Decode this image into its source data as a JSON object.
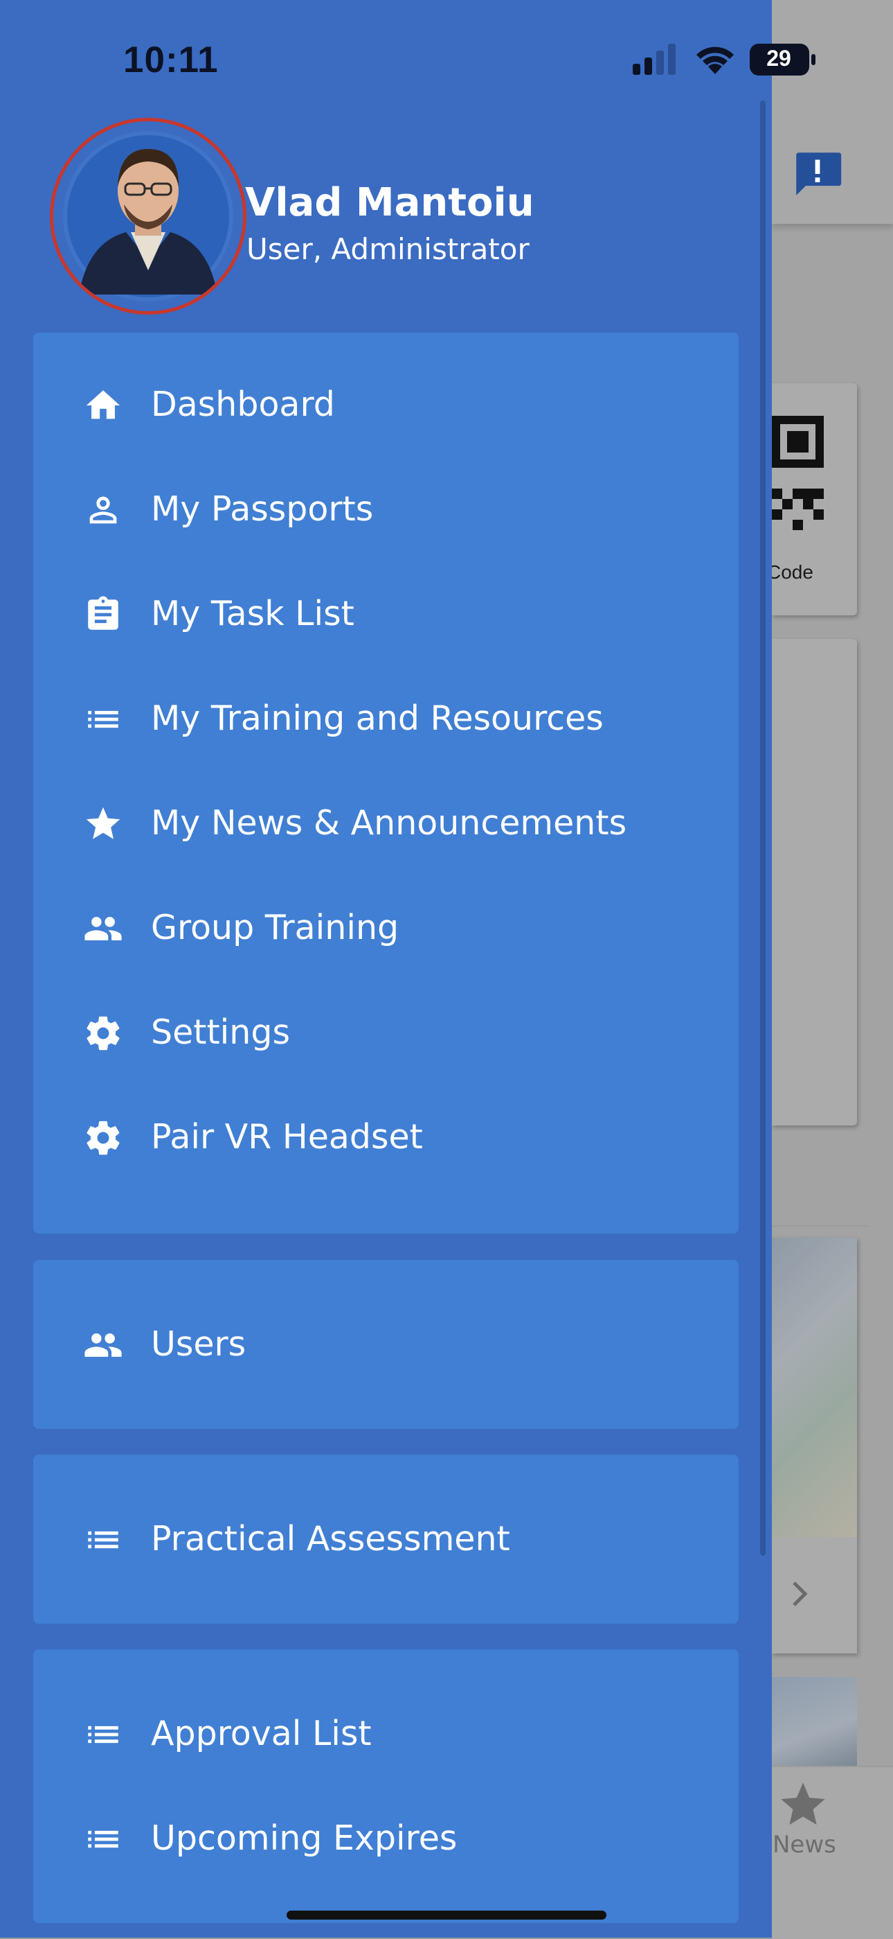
{
  "status_bar": {
    "time": "10:11",
    "battery": "29"
  },
  "profile": {
    "name": "Vlad Mantoiu",
    "role": "User, Administrator"
  },
  "menu_sections": [
    {
      "items": [
        {
          "label": "Dashboard",
          "icon": "home-icon"
        },
        {
          "label": "My Passports",
          "icon": "person-icon"
        },
        {
          "label": "My Task List",
          "icon": "clipboard-icon"
        },
        {
          "label": "My Training and Resources",
          "icon": "list-icon"
        },
        {
          "label": "My News & Announcements",
          "icon": "star-icon"
        },
        {
          "label": "Group Training",
          "icon": "group-icon"
        },
        {
          "label": "Settings",
          "icon": "gear-icon"
        },
        {
          "label": "Pair VR Headset",
          "icon": "gear-icon"
        }
      ]
    },
    {
      "items": [
        {
          "label": "Users",
          "icon": "group-icon"
        }
      ]
    },
    {
      "items": [
        {
          "label": "Practical Assessment",
          "icon": "list-icon"
        }
      ]
    },
    {
      "items": [
        {
          "label": "Approval List",
          "icon": "list-icon"
        },
        {
          "label": "Upcoming Expires",
          "icon": "list-icon"
        }
      ]
    }
  ],
  "background": {
    "qr_label": "Code",
    "tab_news": "News"
  },
  "colors": {
    "drawer": "#3b6cc2",
    "card": "#407fd3",
    "avatar_ring": "#c9372c"
  }
}
